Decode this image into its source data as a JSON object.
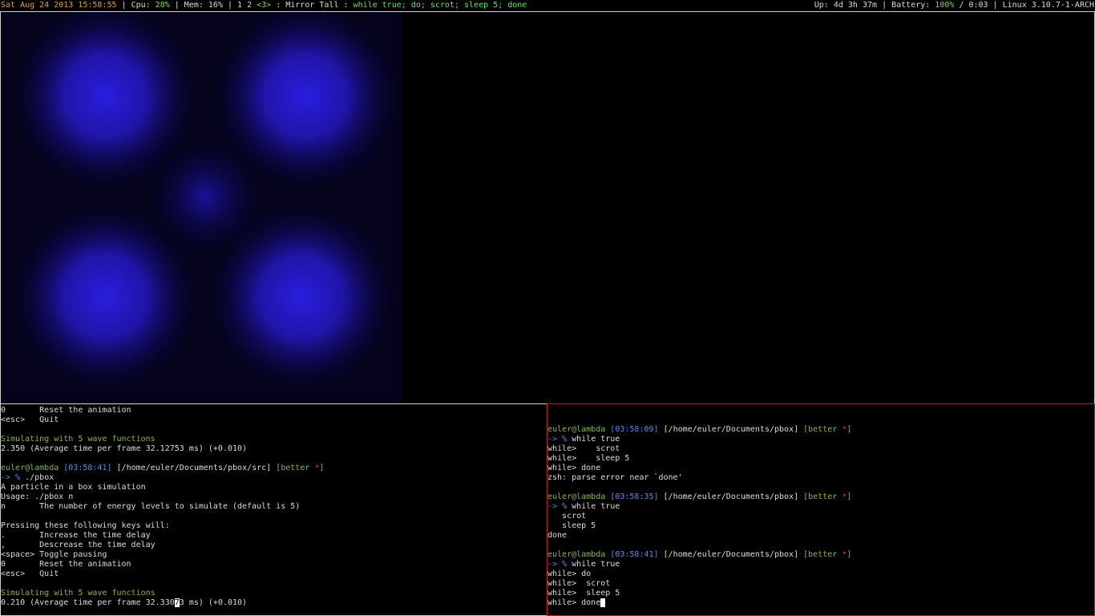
{
  "statusbar": {
    "date": "Sat Aug 24 2013 15:58:55",
    "cpu_label": "Cpu: ",
    "cpu_value": "28%",
    "mem_label": "Mem: ",
    "mem_value": "16%",
    "workspaces": "1 2",
    "active_workspace": "<3>",
    "layout": "Mirror Tall",
    "window_title": "while true; do; scrot; sleep 5; done",
    "uptime": "Up: 4d 3h 37m",
    "battery_label": "Battery: ",
    "battery_value": "100%",
    "battery_time": "/ 0:03",
    "kernel": "Linux 3.10.7-1-ARCH"
  },
  "left_terminal": {
    "lines_top": [
      "0       Reset the animation",
      "<esc>   Quit"
    ],
    "sim1": "Simulating with 5 wave functions",
    "stat1": "2.350 (Average time per frame 32.12753 ms) (+0.010)",
    "prompt": {
      "user": "euler@lambda",
      "time": "[03:58:41]",
      "path": "[/home/euler/Documents/pbox/src]",
      "git": "[better ",
      "star": "*",
      "git_end": "]"
    },
    "arrow": "-> %",
    "command": " ./pbox",
    "output": [
      "A particle in a box simulation",
      "Usage: ./pbox n",
      "n       The number of energy levels to simulate (default is 5)",
      "",
      "Pressing these following keys will:",
      ".       Increase the time delay",
      ",       Descrease the time delay",
      "<space> Toggle pausing",
      "0       Reset the animation",
      "<esc>   Quit"
    ],
    "sim2": "Simulating with 5 wave functions",
    "stat2_before_cursor": "0.210 (Average time per frame 32.330",
    "stat2_cursor": "7",
    "stat2_after_cursor": "3 ms) (+0.010)"
  },
  "right_terminal": {
    "block1": {
      "user": "euler@lambda",
      "time": "[03:58:09]",
      "path": "[/home/euler/Documents/pbox]",
      "git": "[better ",
      "star": "*",
      "git_end": "]",
      "arrow": "-> %",
      "command": " while true",
      "output": [
        "while>    scrot",
        "while>    sleep 5",
        "while> done",
        "zsh: parse error near `done'"
      ]
    },
    "block2": {
      "user": "euler@lambda",
      "time": "[03:58:35]",
      "path": "[/home/euler/Documents/pbox]",
      "git": "[better ",
      "star": "*",
      "git_end": "]",
      "arrow": "-> %",
      "command": " while true",
      "output": [
        "   scrot",
        "   sleep 5",
        "done"
      ]
    },
    "block3": {
      "user": "euler@lambda",
      "time": "[03:58:41]",
      "path": "[/home/euler/Documents/pbox]",
      "git": "[better ",
      "star": "*",
      "git_end": "]",
      "arrow": "-> %",
      "command": " while true",
      "output": [
        "while> do",
        "while>  scrot",
        "while>  sleep 5"
      ],
      "last_line": "while> done"
    }
  },
  "colors": {
    "focus_border": "#d01c1c",
    "blob_color": "#2a1ee0"
  }
}
